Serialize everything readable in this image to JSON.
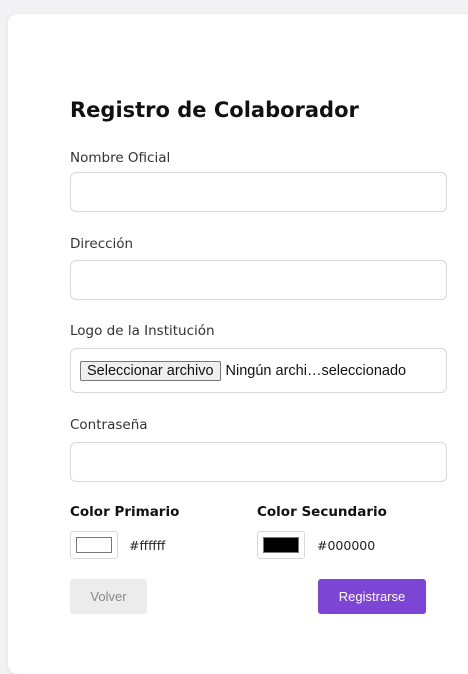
{
  "form": {
    "title": "Registro de Colaborador",
    "fields": {
      "official_name": {
        "label": "Nombre Oficial",
        "value": ""
      },
      "address": {
        "label": "Dirección",
        "value": ""
      },
      "logo": {
        "label": "Logo de la Institución",
        "button_label": "Seleccionar archivo",
        "status_text": "Ningún archi…seleccionado"
      },
      "password": {
        "label": "Contraseña",
        "value": ""
      }
    },
    "colors": {
      "primary": {
        "label": "Color Primario",
        "value": "#ffffff"
      },
      "secondary": {
        "label": "Color Secundario",
        "value": "#000000"
      }
    },
    "buttons": {
      "back_label": "Volver",
      "register_label": "Registrarse"
    }
  },
  "theme": {
    "accent": "#7d45d6",
    "page_background": "#f2f2f5",
    "card_background": "#ffffff"
  }
}
